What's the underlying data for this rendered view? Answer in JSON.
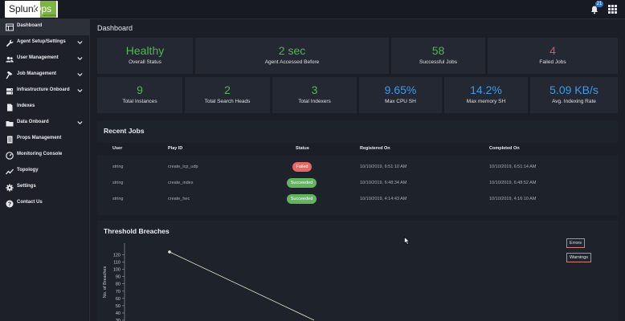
{
  "header": {
    "logo_text_1": "Splunk",
    "logo_text_2": "Ops",
    "logo_sub": "accessibility",
    "notification_count": "21",
    "icons": [
      "bell-icon",
      "apps-grid-icon"
    ]
  },
  "sidebar": {
    "items": [
      {
        "label": "Dashboard",
        "icon": "dashboard-icon",
        "active": true,
        "expandable": false
      },
      {
        "label": "Agent Setup/Settings",
        "icon": "wrench-icon",
        "active": false,
        "expandable": true
      },
      {
        "label": "User Management",
        "icon": "users-icon",
        "active": false,
        "expandable": true
      },
      {
        "label": "Job Management",
        "icon": "hammer-icon",
        "active": false,
        "expandable": true
      },
      {
        "label": "Infrastructure Onboard",
        "icon": "server-icon",
        "active": false,
        "expandable": true
      },
      {
        "label": "Indexes",
        "icon": "file-icon",
        "active": false,
        "expandable": false
      },
      {
        "label": "Data Onboard",
        "icon": "folder-icon",
        "active": false,
        "expandable": true
      },
      {
        "label": "Props Management",
        "icon": "document-icon",
        "active": false,
        "expandable": false
      },
      {
        "label": "Monitoring Console",
        "icon": "gauge-icon",
        "active": false,
        "expandable": false
      },
      {
        "label": "Topology",
        "icon": "chart-line-icon",
        "active": false,
        "expandable": false
      },
      {
        "label": "Settings",
        "icon": "gear-icon",
        "active": false,
        "expandable": false
      },
      {
        "label": "Contact Us",
        "icon": "help-icon",
        "active": false,
        "expandable": false
      }
    ]
  },
  "main": {
    "title": "Dashboard",
    "stats_row1": [
      {
        "value": "Healthy",
        "label": "Overall Status",
        "color": "#4fb84f"
      },
      {
        "value": "2 sec",
        "label": "Agent Accessed Before",
        "color": "#4fb84f"
      },
      {
        "value": "58",
        "label": "Successful Jobs",
        "color": "#4fb84f"
      },
      {
        "value": "4",
        "label": "Failed Jobs",
        "color": "#e8495b"
      }
    ],
    "stats_row2": [
      {
        "value": "9",
        "label": "Total Instances",
        "color": "#4fb84f"
      },
      {
        "value": "2",
        "label": "Total Search Heads",
        "color": "#4fb84f"
      },
      {
        "value": "3",
        "label": "Total Indexers",
        "color": "#4fb84f"
      },
      {
        "value": "9.65%",
        "label": "Max CPU SH",
        "color": "#3d9ae8"
      },
      {
        "value": "14.2%",
        "label": "Max memory SH",
        "color": "#3d9ae8"
      },
      {
        "value": "5.09 KB/s",
        "label": "Avg. Indexing Rate",
        "color": "#3d9ae8"
      }
    ]
  },
  "recent_jobs": {
    "title": "Recent Jobs",
    "columns": [
      "User",
      "Play ID",
      "Status",
      "Registered On",
      "Completed On"
    ],
    "rows": [
      {
        "user": "string",
        "play_id": "create_lcp_udp",
        "status": "Failed",
        "status_type": "fail",
        "registered": "10/10/2019, 6:51:10 AM",
        "completed": "10/10/2019, 6:51:14 AM"
      },
      {
        "user": "string",
        "play_id": "create_index",
        "status": "Succeeded",
        "status_type": "ok",
        "registered": "10/10/2019, 6:48:34 AM",
        "completed": "10/10/2019, 6:48:52 AM"
      },
      {
        "user": "string",
        "play_id": "create_hec",
        "status": "Succeeded",
        "status_type": "ok",
        "registered": "10/10/2019, 4:14:43 AM",
        "completed": "10/10/2019, 4:16:10 AM"
      }
    ],
    "status_colors": {
      "fail": "#e86866",
      "ok": "#62b55e"
    }
  },
  "threshold": {
    "title": "Threshold Breaches",
    "legend": [
      "Errors",
      "Warnings"
    ]
  },
  "chart_data": {
    "type": "line",
    "title": "Threshold Breaches",
    "ylabel": "No. of Breaches",
    "xlabel": "",
    "y_ticks": [
      120,
      110,
      100,
      90,
      80,
      70,
      60,
      50,
      40,
      30
    ],
    "ylim": [
      30,
      125
    ],
    "series": [
      {
        "name": "Errors",
        "color": "#e6e3c7",
        "points": [
          {
            "x": 0,
            "y": 124
          },
          {
            "x": 1,
            "y": 30
          }
        ]
      }
    ],
    "legend_placement": "top-right",
    "grid": false
  }
}
